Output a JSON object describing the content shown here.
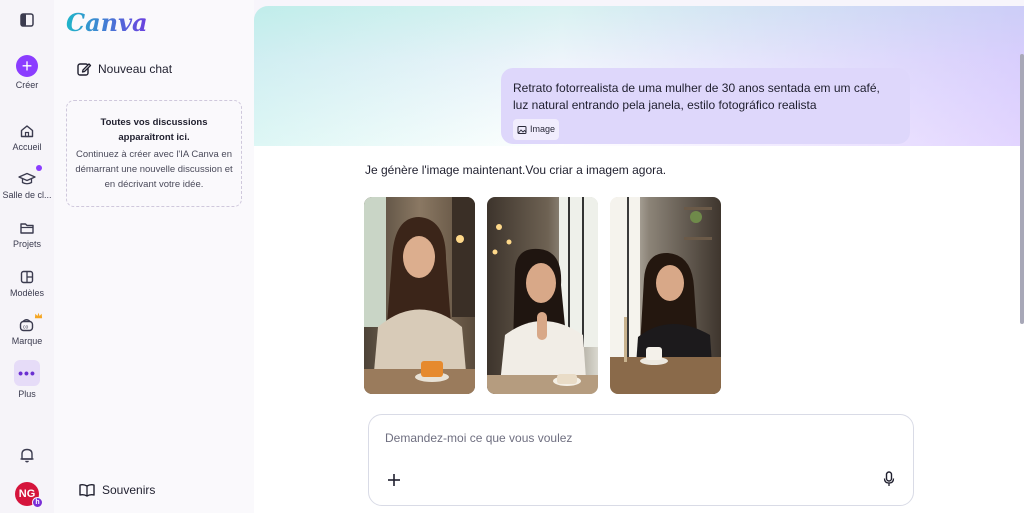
{
  "brand": {
    "logo_text": "Canva"
  },
  "rail": {
    "items": [
      {
        "label": "Créer",
        "icon": "plus-icon"
      },
      {
        "label": "Accueil",
        "icon": "home-icon"
      },
      {
        "label": "Salle de cl...",
        "icon": "graduation-cap-icon"
      },
      {
        "label": "Projets",
        "icon": "folder-icon"
      },
      {
        "label": "Modèles",
        "icon": "templates-icon"
      },
      {
        "label": "Marque",
        "icon": "brand-icon"
      },
      {
        "label": "Plus",
        "icon": "more-icon"
      }
    ],
    "avatar_initials": "NG",
    "avatar_badge": "h"
  },
  "panel": {
    "new_chat_label": "Nouveau chat",
    "empty_title": "Toutes vos discussions apparaîtront ici.",
    "empty_body": "Continuez à créer avec l'IA Canva en démarrant une nouvelle discussion et en décrivant votre idée.",
    "souvenirs_label": "Souvenirs"
  },
  "chat": {
    "user_message": "Retrato fotorrealista de uma mulher de 30 anos sentada em um café, luz natural entrando pela janela, estilo fotográfico realista",
    "attachment_chip": "Image",
    "assistant_reply": "Je génère l'image maintenant.Vou criar a imagem agora.",
    "images": [
      {
        "description": "woman-cream-sweater-coffee-cup"
      },
      {
        "description": "woman-white-shirt-chin-on-hand"
      },
      {
        "description": "woman-black-top-window-cafe"
      }
    ]
  },
  "composer": {
    "placeholder": "Demandez-moi ce que vous voulez",
    "value": ""
  },
  "colors": {
    "accent": "#8b3dff",
    "user_bubble": "#ded7fb",
    "avatar": "#d5143c"
  }
}
